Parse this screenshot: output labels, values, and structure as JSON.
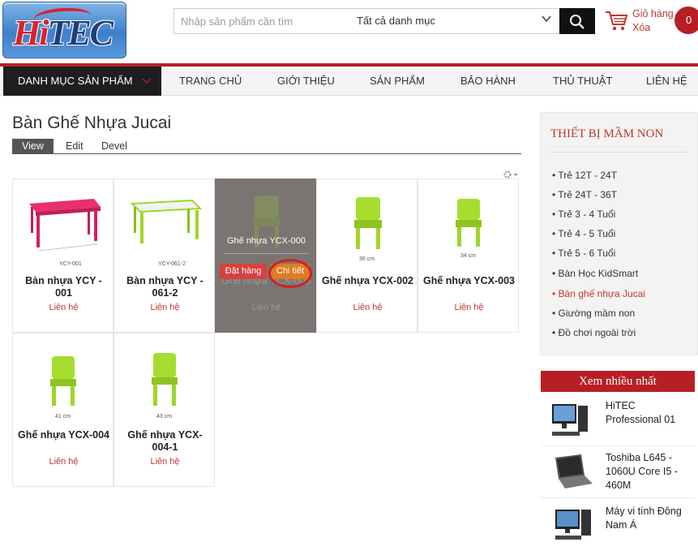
{
  "header": {
    "logo_text": "HiTEC",
    "search_placeholder": "Nhập sản phẩm cần tìm",
    "search_category": "Tất cả danh mục",
    "cart_title": "Giỏ hàng",
    "cart_sub": "Xóa",
    "cart_count": "0"
  },
  "nav": {
    "category_label": "DANH MỤC SẢN PHẨM",
    "items": [
      "TRANG CHỦ",
      "GIỚI THIỆU",
      "SẢN PHẨM",
      "BẢO HÀNH",
      "THỦ THUẬT",
      "LIÊN HỆ"
    ]
  },
  "main": {
    "title": "Bàn Ghế Nhựa Jucai",
    "tabs": [
      "View",
      "Edit",
      "Devel"
    ],
    "products": [
      {
        "name": "Bàn nhựa YCY - 001",
        "price": "Liên hệ",
        "size": ""
      },
      {
        "name": "Bàn nhựa YCY - 061-2",
        "price": "Liên hệ",
        "size": ""
      },
      {
        "name": "Ghế nhựa YCX-000",
        "price": "Liên hệ",
        "size": "25 cm"
      },
      {
        "name": "Ghế nhựa YCX-002",
        "price": "Liên hệ",
        "size": "36 cm"
      },
      {
        "name": "Ghế nhựa YCX-003",
        "price": "Liên hệ",
        "size": "34 cm"
      },
      {
        "name": "Ghế nhựa YCX-004",
        "price": "Liên hệ",
        "size": "41 cm"
      },
      {
        "name": "Ghế nhựa YCX-004-1",
        "price": "Liên hệ",
        "size": "43 cm"
      }
    ],
    "overlay": {
      "title": "Ghế nhựa YCX-000",
      "order_label": "Đặt hàng",
      "detail_label": "Chi tiết"
    }
  },
  "sidebar": {
    "title": "THIẾT BỊ MẦM NON",
    "items": [
      "Trẻ 12T - 24T",
      "Trẻ 24T - 36T",
      "Trẻ 3 - 4 Tuổi",
      "Trẻ 4 - 5 Tuổi",
      "Trẻ 5 - 6 Tuổi",
      "Bàn Học KidSmart",
      "Bàn ghế nhựa Jucai",
      "Giường mầm non",
      "Đồ chơi ngoài trời"
    ],
    "active_index": 6,
    "popular_title": "Xem nhiều nhất",
    "popular": [
      {
        "name": "HiTEC Professional 01"
      },
      {
        "name": "Toshiba L645 - 1060U Core I5 - 460M"
      },
      {
        "name": "Máy vi tính Đông Nam Á"
      }
    ]
  },
  "colors": {
    "brand_red": "#b71f25",
    "chair_green": "#9ed62a",
    "table_pink": "#e8306a"
  }
}
